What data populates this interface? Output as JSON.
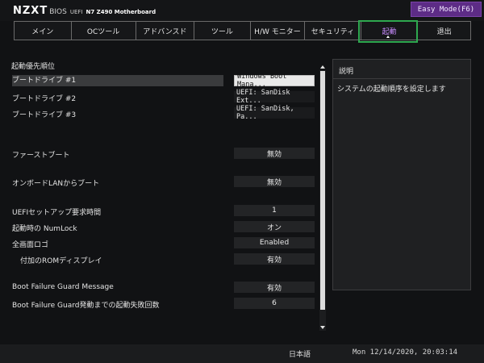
{
  "header": {
    "brand": "NZXT",
    "bios": "BIOS",
    "uefi": "UEFI",
    "board": "N7 Z490 Motherboard",
    "easy_mode": "Easy Mode(F6)"
  },
  "tabs": [
    "メイン",
    "OCツール",
    "アドバンスド",
    "ツール",
    "H/W モニター",
    "セキュリティ",
    "起動",
    "退出"
  ],
  "section_title": "起動優先順位",
  "rows": {
    "boot1_label": "ブートドライブ #1",
    "boot1_value": "Windows Boot Mana...",
    "boot2_label": "ブートドライブ #2",
    "boot2_value": "UEFI: SanDisk Ext...",
    "boot3_label": "ブートドライブ #3",
    "boot3_value": "UEFI: SanDisk, Pa...",
    "fastboot_label": "ファーストブート",
    "fastboot_value": "無効",
    "lanboot_label": "オンボードLANからブート",
    "lanboot_value": "無効",
    "setup_wait_label": "UEFIセットアップ要求時間",
    "setup_wait_value": "1",
    "numlock_label": "起動時の NumLock",
    "numlock_value": "オン",
    "fulllogo_label": "全画面ロゴ",
    "fulllogo_value": "Enabled",
    "optionrom_label": "付加のROMディスプレイ",
    "optionrom_value": "有効",
    "bfgm_label": "Boot Failure Guard Message",
    "bfgm_value": "有効",
    "bfg_count_label": "Boot Failure Guard発動までの起動失敗回数",
    "bfg_count_value": "6"
  },
  "help": {
    "title": "説明",
    "text": "システムの起動順序を設定します"
  },
  "footer": {
    "language": "日本語",
    "datetime": "Mon 12/14/2020, 20:03:14"
  },
  "colors": {
    "active_tab_text": "#c88cff",
    "active_tab_border": "#2ea84f",
    "easy_mode_bg": "#5d2c86"
  }
}
